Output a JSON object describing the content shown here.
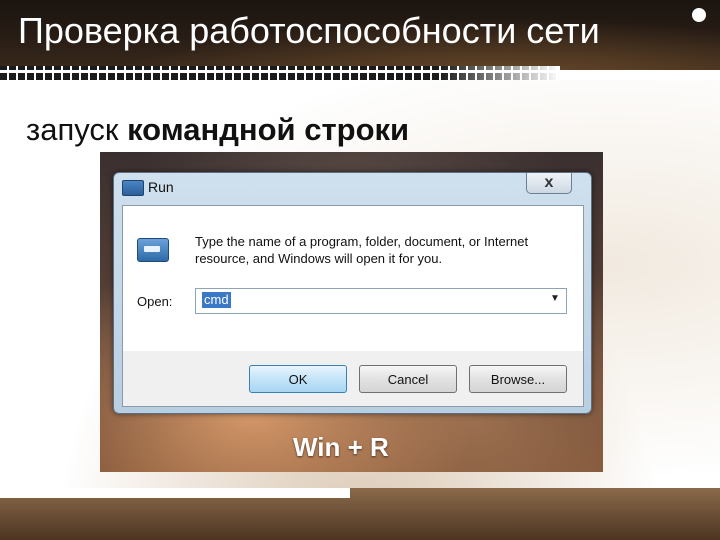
{
  "slide": {
    "title": "Проверка работоспособности сети",
    "subtitle_normal": "запуск ",
    "subtitle_bold": "командной строки",
    "shortcut": "Win + R"
  },
  "dialog": {
    "title": "Run",
    "close_label": "x",
    "description": "Type the name of a program, folder, document, or Internet resource, and Windows will open it for you.",
    "open_label": "Open:",
    "open_value": "cmd",
    "dropdown_arrow": "▼",
    "ok_label": "OK",
    "cancel_label": "Cancel",
    "browse_label": "Browse..."
  },
  "icons": {
    "dialog_icon": "run-window-icon",
    "run_icon": "run-program-icon",
    "close": "close-icon"
  }
}
